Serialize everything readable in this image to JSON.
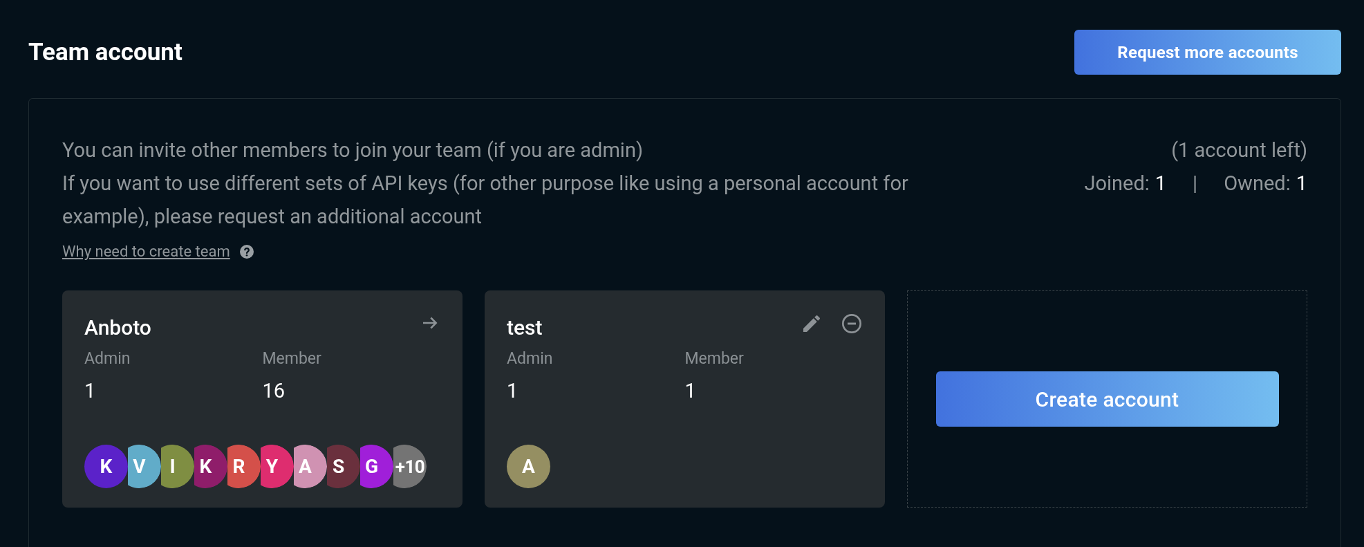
{
  "header": {
    "title": "Team account",
    "request_button": "Request more accounts"
  },
  "panel": {
    "description": [
      "You can invite other members to join your team (if you are admin)",
      "If you want to use different sets of API keys (for other purpose like using a personal account for example), please request an additional account"
    ],
    "help_link": "Why need to create team",
    "accounts_left": "(1 account left)",
    "stats": [
      {
        "label": "Joined:",
        "value": "1"
      },
      {
        "label": "Owned:",
        "value": "1"
      }
    ],
    "separator": "|",
    "teams": [
      {
        "name": "Anboto",
        "kind": "joined",
        "admin_label": "Admin",
        "admin": "1",
        "member_label": "Member",
        "member": "16",
        "more": "+10",
        "avatars": [
          {
            "initial": "K",
            "color": "#5b22c9"
          },
          {
            "initial": "V",
            "color": "#61acc9"
          },
          {
            "initial": "I",
            "color": "#7f8e42"
          },
          {
            "initial": "K",
            "color": "#8f1d6a"
          },
          {
            "initial": "R",
            "color": "#d4504a"
          },
          {
            "initial": "Y",
            "color": "#de2d6f"
          },
          {
            "initial": "A",
            "color": "#d092b2"
          },
          {
            "initial": "S",
            "color": "#6a303d"
          },
          {
            "initial": "G",
            "color": "#a01fd9"
          }
        ]
      },
      {
        "name": "test",
        "kind": "owned",
        "admin_label": "Admin",
        "admin": "1",
        "member_label": "Member",
        "member": "1",
        "avatars": [
          {
            "initial": "A",
            "color": "#958f62"
          }
        ]
      }
    ],
    "create_button": "Create account"
  }
}
